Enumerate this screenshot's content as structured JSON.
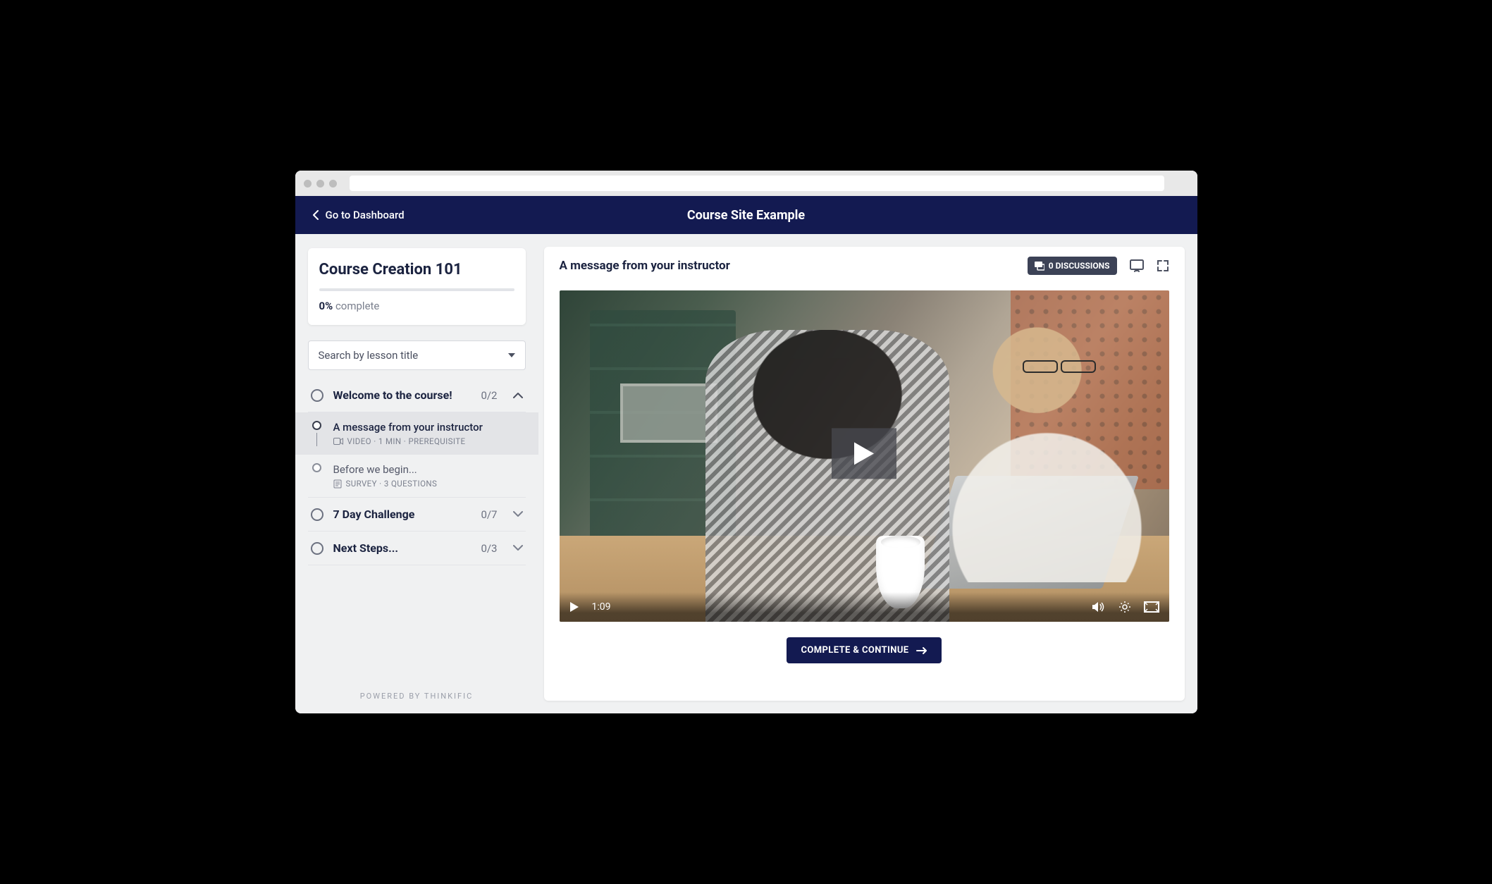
{
  "nav": {
    "dashboard_label": "Go to Dashboard",
    "site_title": "Course Site Example"
  },
  "course": {
    "title": "Course Creation 101",
    "progress_percent": "0%",
    "progress_word": "complete"
  },
  "search": {
    "placeholder": "Search by lesson title"
  },
  "chapters": [
    {
      "title": "Welcome to the course!",
      "count": "0/2",
      "expanded": true,
      "lessons": [
        {
          "title": "A message from your instructor",
          "meta": "VIDEO · 1 MIN  ·  PREREQUISITE",
          "type": "video",
          "active": true
        },
        {
          "title": "Before we begin...",
          "meta": "SURVEY · 3 QUESTIONS",
          "type": "survey",
          "active": false
        }
      ]
    },
    {
      "title": "7 Day Challenge",
      "count": "0/7",
      "expanded": false
    },
    {
      "title": "Next Steps...",
      "count": "0/3",
      "expanded": false
    }
  ],
  "content": {
    "lesson_title": "A message from your instructor",
    "discussions_label": "0 DISCUSSIONS",
    "video_time": "1:09",
    "complete_label": "COMPLETE & CONTINUE"
  },
  "footer": {
    "powered_by": "POWERED BY THINKIFIC"
  }
}
